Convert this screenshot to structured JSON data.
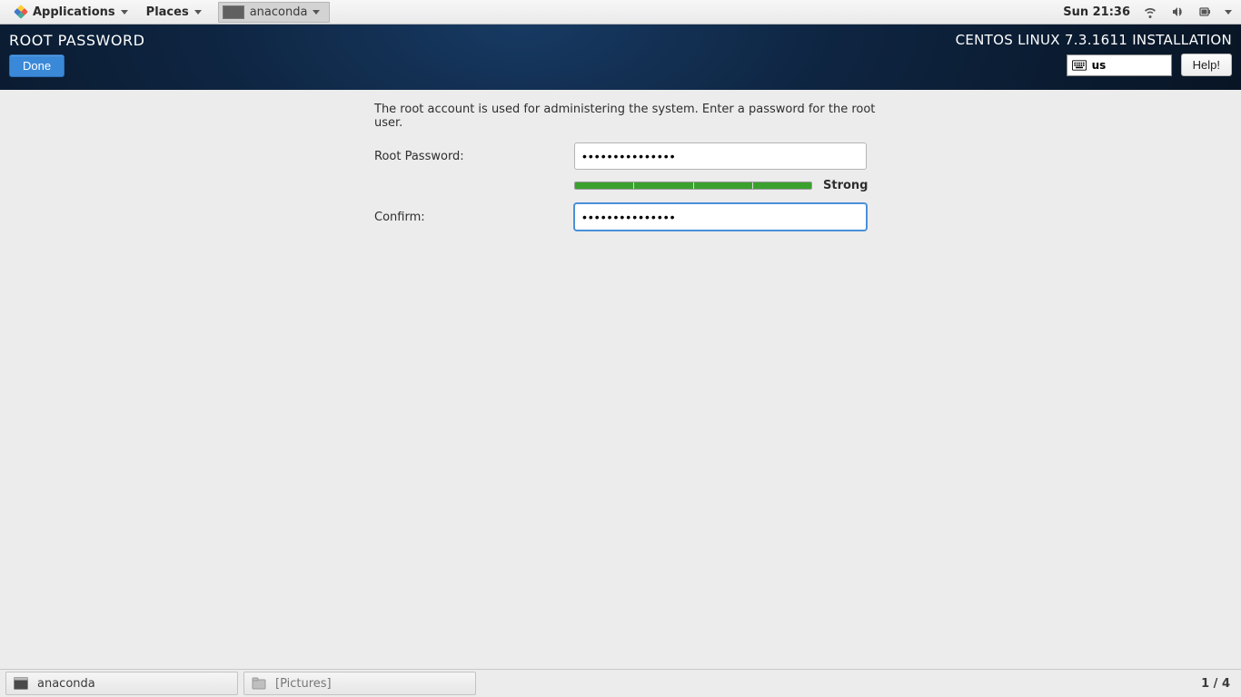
{
  "gnome": {
    "applications_label": "Applications",
    "places_label": "Places",
    "task_label": "anaconda",
    "clock": "Sun 21:36"
  },
  "header": {
    "title": "ROOT PASSWORD",
    "done_label": "Done",
    "install_title": "CENTOS LINUX 7.3.1611 INSTALLATION",
    "keyboard_layout": "us",
    "help_label": "Help!"
  },
  "form": {
    "instruction": "The root account is used for administering the system.  Enter a password for the root user.",
    "root_label": "Root Password:",
    "confirm_label": "Confirm:",
    "root_value": "•••••••••••••••",
    "confirm_value": "•••••••••••••••",
    "strength_text": "Strong"
  },
  "bottombar": {
    "task1": "anaconda",
    "task2": "[Pictures]",
    "workspace": "1 / 4"
  }
}
